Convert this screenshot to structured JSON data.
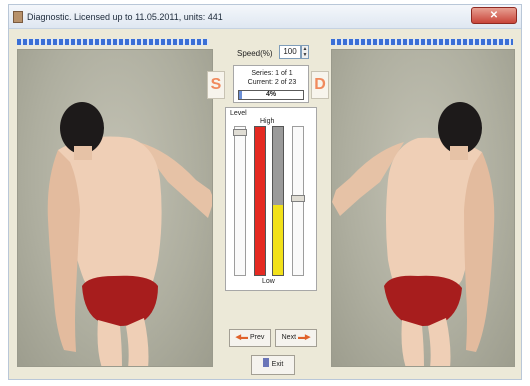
{
  "window": {
    "title": "Diagnostic. Licensed up to 11.05.2011, units: 441"
  },
  "controls": {
    "speed_label": "Speed(%)",
    "speed_value": "100",
    "left_button": "S",
    "right_button": "D"
  },
  "series": {
    "series_text": "Series: 1 of 1",
    "current_text": "Current: 2 of 23",
    "progress_text": "4%",
    "progress_value": 4
  },
  "level_panel": {
    "level_label": "Level",
    "high_label": "High",
    "low_label": "Low",
    "yellow_fill_fraction": 0.47
  },
  "buttons": {
    "prev_label": "Prev",
    "next_label": "Next",
    "exit_label": "Exit"
  },
  "icons": {
    "app": "app-icon",
    "close": "close-icon",
    "prev_arrow": "left-arrow-icon",
    "next_arrow": "right-arrow-icon",
    "exit": "door-icon"
  },
  "colors": {
    "accent_blue": "#3a6fd6",
    "red_bar": "#e52a22",
    "yellow_bar": "#f2e11a",
    "side_button_text": "#f08a5d"
  }
}
